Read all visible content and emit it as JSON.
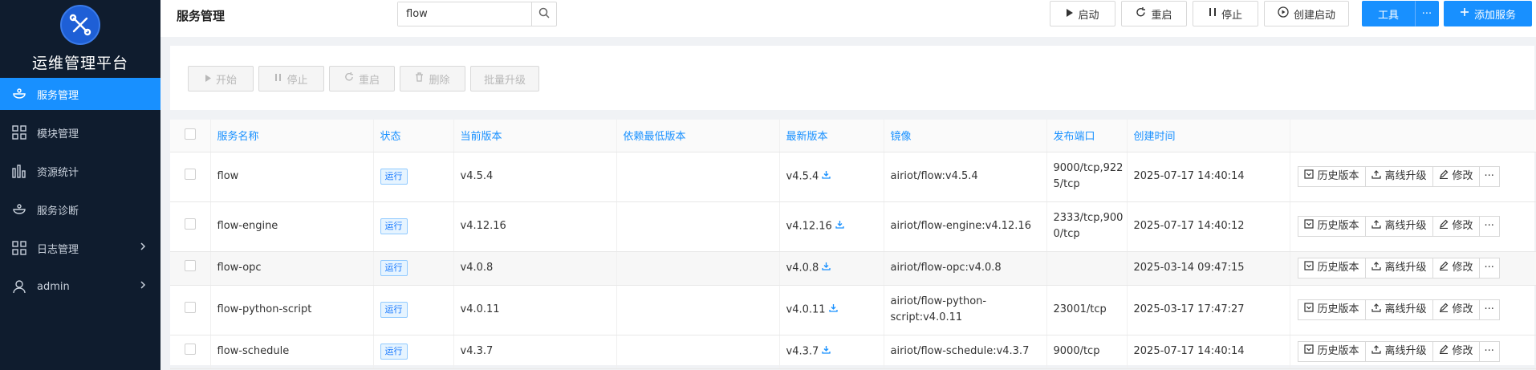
{
  "sidebar": {
    "brand": "运维管理平台",
    "items": [
      {
        "label": "服务管理",
        "icon": "service-icon"
      },
      {
        "label": "模块管理",
        "icon": "module-grid-icon"
      },
      {
        "label": "资源统计",
        "icon": "bar-chart-icon"
      },
      {
        "label": "服务诊断",
        "icon": "diagnosis-icon"
      },
      {
        "label": "日志管理",
        "icon": "log-grid-icon"
      },
      {
        "label": "admin",
        "icon": "user-icon"
      }
    ]
  },
  "header": {
    "title": "服务管理",
    "search_value": "flow",
    "buttons": {
      "start": "启动",
      "restart": "重启",
      "stop": "停止",
      "create_start": "创建启动",
      "tools": "工具",
      "more": "···",
      "add_service": "添加服务"
    }
  },
  "bulk_actions": {
    "start": "开始",
    "stop": "停止",
    "restart": "重启",
    "delete": "删除",
    "batch_upgrade": "批量升级"
  },
  "table": {
    "columns": [
      "服务名称",
      "状态",
      "当前版本",
      "依赖最低版本",
      "最新版本",
      "镜像",
      "发布端口",
      "创建时间"
    ],
    "row_actions": {
      "history": "历史版本",
      "offline_upgrade": "离线升级",
      "edit": "修改",
      "more": "···"
    },
    "rows": [
      {
        "name": "flow",
        "status": "运行",
        "current_version": "v4.5.4",
        "min_dep_version": "",
        "latest_version": "v4.5.4",
        "image": "airiot/flow:v4.5.4",
        "port_line1": "9000/tcp,922",
        "port_line2": "5/tcp",
        "created": "2025-07-17 14:40:14"
      },
      {
        "name": "flow-engine",
        "status": "运行",
        "current_version": "v4.12.16",
        "min_dep_version": "",
        "latest_version": "v4.12.16",
        "image": "airiot/flow-engine:v4.12.16",
        "port_line1": "2333/tcp,900",
        "port_line2": "0/tcp",
        "created": "2025-07-17 14:40:12"
      },
      {
        "name": "flow-opc",
        "status": "运行",
        "current_version": "v4.0.8",
        "min_dep_version": "",
        "latest_version": "v4.0.8",
        "image": "airiot/flow-opc:v4.0.8",
        "port_line1": "",
        "port_line2": "",
        "created": "2025-03-14 09:47:15"
      },
      {
        "name": "flow-python-script",
        "status": "运行",
        "current_version": "v4.0.11",
        "min_dep_version": "",
        "latest_version": "v4.0.11",
        "image_line1": "airiot/flow-python-",
        "image_line2": "script:v4.0.11",
        "port_line1": "23001/tcp",
        "port_line2": "",
        "created": "2025-03-17 17:47:27"
      },
      {
        "name": "flow-schedule",
        "status": "运行",
        "current_version": "v4.3.7",
        "min_dep_version": "",
        "latest_version": "v4.3.7",
        "image": "airiot/flow-schedule:v4.3.7",
        "port_line1": "9000/tcp",
        "port_line2": "",
        "created": "2025-07-17 14:40:14"
      }
    ]
  },
  "colors": {
    "primary": "#1890ff",
    "sidebar_bg": "#0f1c2e",
    "tag_border": "#91caff"
  }
}
